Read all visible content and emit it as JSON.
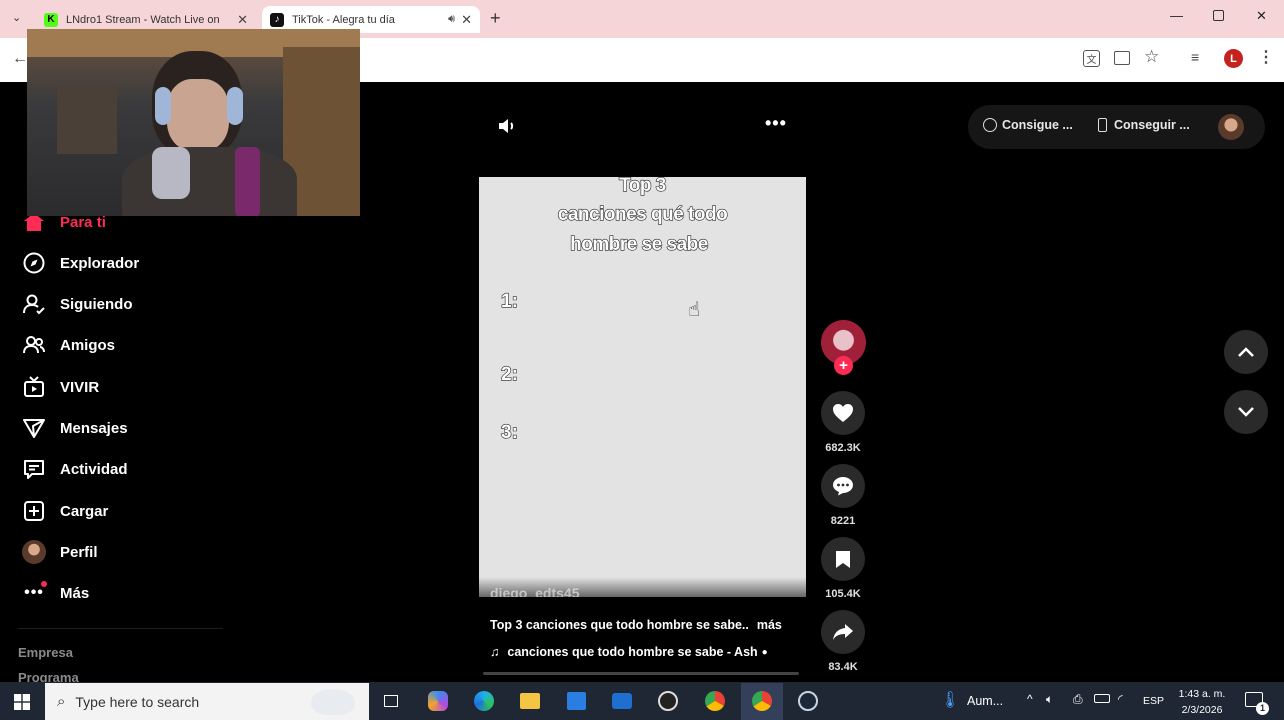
{
  "browser": {
    "tabs": [
      {
        "title": "LNdro1 Stream - Watch Live on",
        "favicon": "kick-icon"
      },
      {
        "title": "TikTok - Alegra tu día",
        "favicon": "tiktok-icon"
      }
    ],
    "profile_initial": "L"
  },
  "header": {
    "button1": "Consigue ...",
    "button2": "Conseguir ..."
  },
  "sidebar": {
    "items": [
      {
        "label": "Para ti",
        "icon": "home-icon",
        "active": true
      },
      {
        "label": "Explorador",
        "icon": "compass-icon"
      },
      {
        "label": "Siguiendo",
        "icon": "following-icon"
      },
      {
        "label": "Amigos",
        "icon": "friends-icon"
      },
      {
        "label": "VIVIR",
        "icon": "live-tv-icon"
      },
      {
        "label": "Mensajes",
        "icon": "send-icon"
      },
      {
        "label": "Actividad",
        "icon": "activity-icon"
      },
      {
        "label": "Cargar",
        "icon": "upload-icon"
      },
      {
        "label": "Perfil",
        "icon": "avatar"
      },
      {
        "label": "Más",
        "icon": "more-icon"
      }
    ],
    "footer": [
      "Empresa",
      "Programa"
    ]
  },
  "video": {
    "overlay_title": [
      "Top 3",
      "canciones qué todo",
      "hombre se sabe"
    ],
    "numbers": [
      "1:",
      "2:",
      "3:"
    ],
    "watermark": "diego_edts45",
    "description": "Top 3 canciones que todo hombre se sabe..",
    "more": "más",
    "music": "canciones que todo hombre se sabe - Ash"
  },
  "actions": {
    "likes": "682.3K",
    "comments": "8221",
    "saves": "105.4K",
    "shares": "83.4K"
  },
  "taskbar": {
    "search_placeholder": "Type here to search",
    "weather": "Aum...",
    "language": "ESP",
    "time": "1:43 a. m.",
    "date": "2/3/2026",
    "notifications": "1"
  },
  "colors": {
    "accent": "#fe2c55",
    "background": "#000000",
    "tabbar": "#f6d5d9"
  }
}
